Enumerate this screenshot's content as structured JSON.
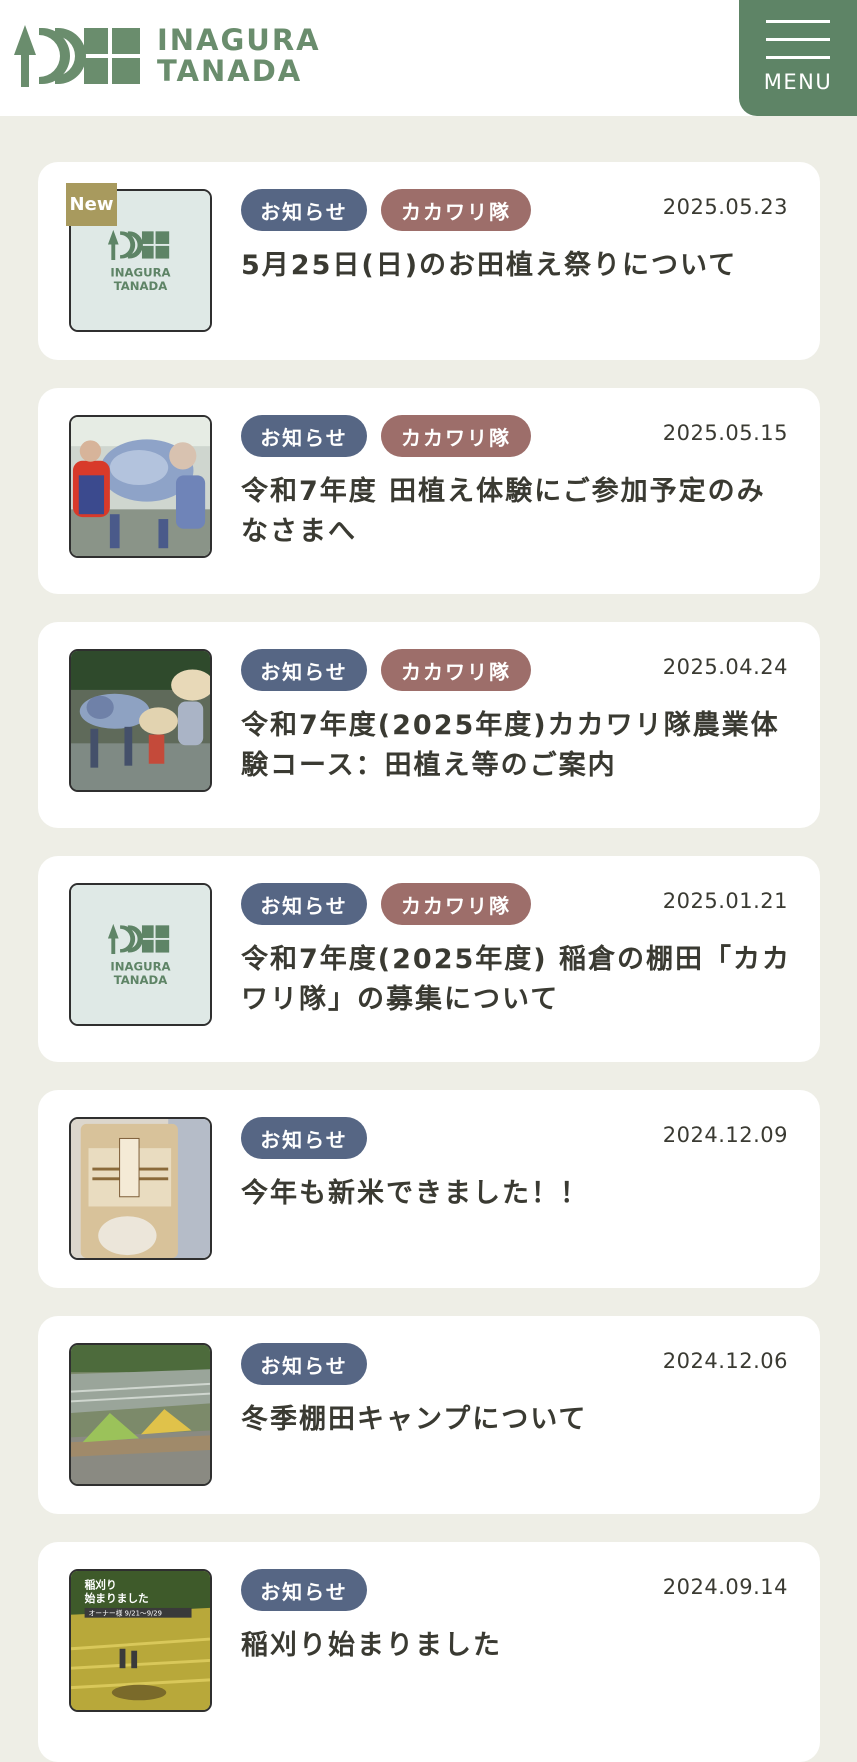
{
  "header": {
    "logo_line1": "INAGURA",
    "logo_line2": "TANADA",
    "menu_label": "MENU"
  },
  "colors": {
    "brand_green": "#5e8466",
    "tag_info": "#566684",
    "tag_kakawari": "#9d6e6a",
    "new_badge": "#a89a5e",
    "background": "#eeeee6"
  },
  "thumb_logo": {
    "line1": "INAGURA",
    "line2": "TANADA"
  },
  "new_label": "New",
  "posts": [
    {
      "date": "2025.05.23",
      "tags": [
        "お知らせ",
        "カカワリ隊"
      ],
      "title": "5月25日(日)のお田植え祭りについて",
      "image": "logo-placeholder",
      "is_new": true
    },
    {
      "date": "2025.05.15",
      "tags": [
        "お知らせ",
        "カカワリ隊"
      ],
      "title": "令和7年度 田植え体験にご参加予定のみなさまへ",
      "image": "photo-rice-planting-kids"
    },
    {
      "date": "2025.04.24",
      "tags": [
        "お知らせ",
        "カカワリ隊"
      ],
      "title": "令和7年度(2025年度)カカワリ隊農業体験コース：田植え等のご案内",
      "image": "photo-rice-planting-hats"
    },
    {
      "date": "2025.01.21",
      "tags": [
        "お知らせ",
        "カカワリ隊"
      ],
      "title": "令和7年度(2025年度) 稲倉の棚田「カカワリ隊」の募集について",
      "image": "logo-placeholder"
    },
    {
      "date": "2024.12.09",
      "tags": [
        "お知らせ"
      ],
      "title": "今年も新米できました！！",
      "image": "photo-rice-bag"
    },
    {
      "date": "2024.12.06",
      "tags": [
        "お知らせ"
      ],
      "title": "冬季棚田キャンプについて",
      "image": "photo-tents-terraces"
    },
    {
      "date": "2024.09.14",
      "tags": [
        "お知らせ"
      ],
      "title": "稲刈り始まりました",
      "image": "photo-harvest-poster",
      "image_text": {
        "line1": "稲刈り",
        "line2": "始まりました",
        "line3": "オーナー様 9/21〜9/29"
      }
    }
  ]
}
